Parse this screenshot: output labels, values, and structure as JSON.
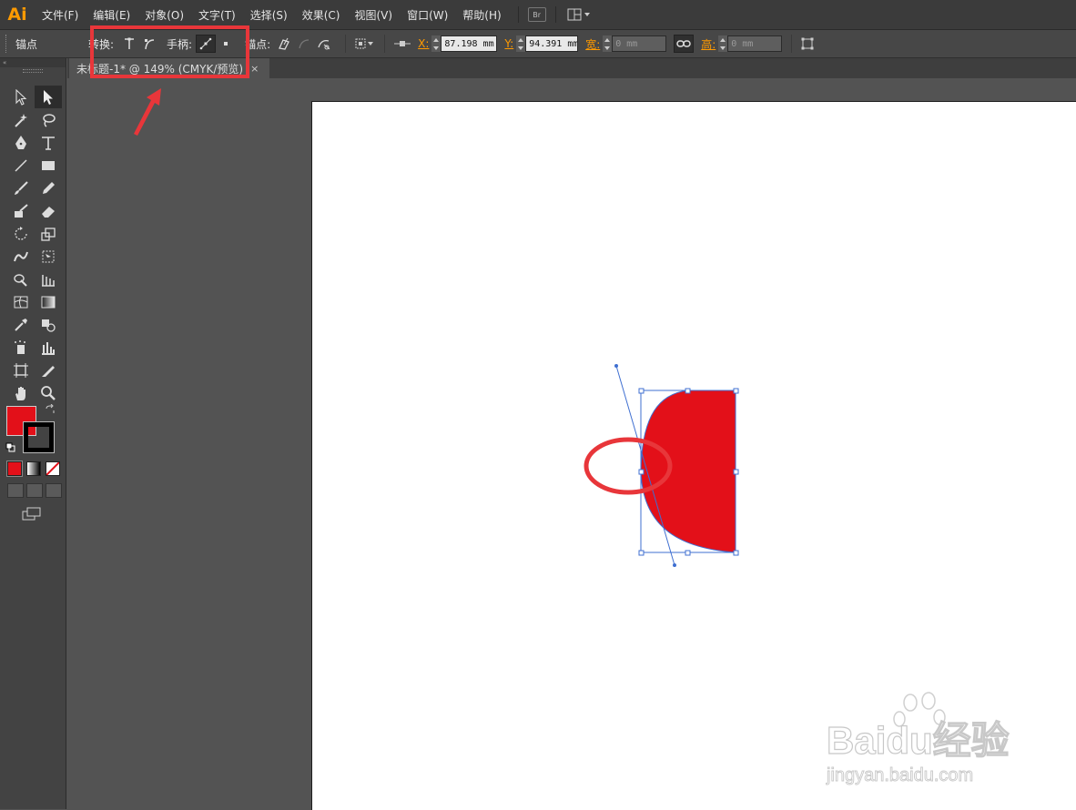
{
  "app": {
    "logo": "Ai"
  },
  "menu": [
    "文件(F)",
    "编辑(E)",
    "对象(O)",
    "文字(T)",
    "选择(S)",
    "效果(C)",
    "视图(V)",
    "窗口(W)",
    "帮助(H)"
  ],
  "bridge_button": "Br",
  "control": {
    "selection_label": "锚点",
    "convert_label": "转换:",
    "handles_label": "手柄:",
    "anchors_label": "锚点:",
    "x_label": "X:",
    "x_value": "87.198 mm",
    "y_label": "Y:",
    "y_value": "94.391 mm",
    "w_label": "宽:",
    "w_value": "0 mm",
    "h_label": "高:",
    "h_value": "0 mm"
  },
  "document_tab": {
    "title": "未标题-1* @ 149% (CMYK/预览)",
    "close": "×"
  },
  "panel_collapse": "«",
  "colors": {
    "fill": "#e31019",
    "stroke": "#000000",
    "annotation": "#e8363a",
    "path": "#3f6fd1"
  },
  "watermark": {
    "brand": "Baidu经验",
    "url": "jingyan.baidu.com"
  }
}
